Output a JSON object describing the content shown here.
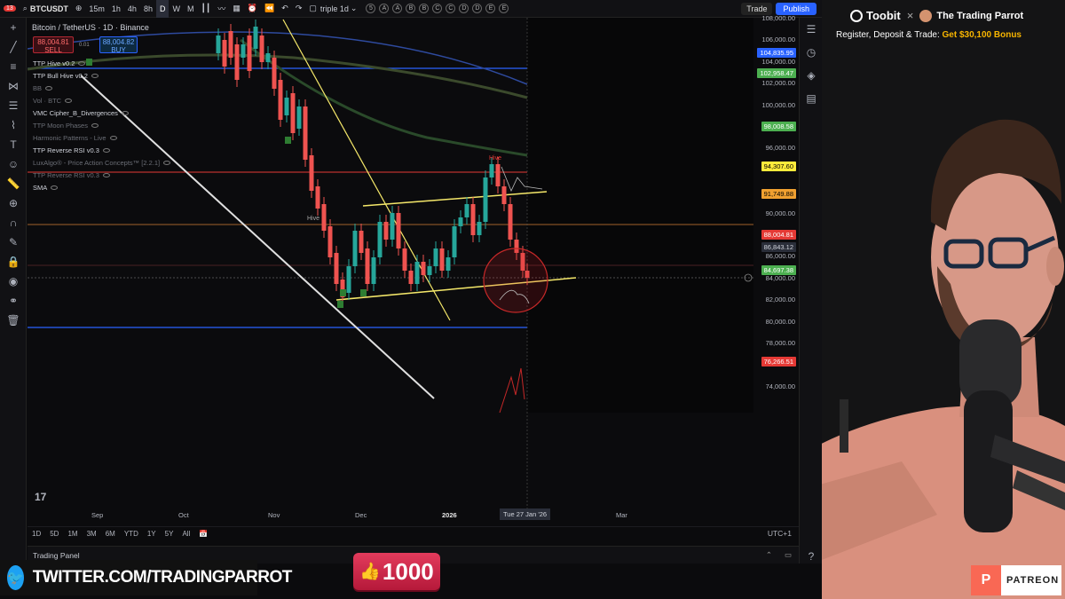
{
  "toolbar": {
    "notif_count": "13",
    "symbol": "BTCUSDT",
    "intervals": [
      "15m",
      "1h",
      "4h",
      "8h",
      "D",
      "W",
      "M"
    ],
    "active_interval": "D",
    "layout_name": "triple 1d",
    "slot_labels": [
      "5",
      "A",
      "A",
      "B",
      "B",
      "C",
      "C",
      "D",
      "D",
      "E",
      "E"
    ],
    "trade_label": "Trade",
    "publish_label": "Publish"
  },
  "chart": {
    "title": "Bitcoin / TetherUS · 1D · Binance",
    "sell_price": "88,004.81",
    "sell_label": "SELL",
    "spread": "0.01",
    "buy_price": "88,004.82",
    "buy_label": "BUY",
    "currency": "USDT",
    "indicators": [
      {
        "label": "TTP Hive v0.2",
        "color": "#d1d4dc"
      },
      {
        "label": "TTP Bull Hive v0.2",
        "color": "#d1d4dc"
      },
      {
        "label": "BB",
        "color": "#6b6e76"
      },
      {
        "label": "Vol · BTC",
        "color": "#6b6e76"
      },
      {
        "label": "VMC Cipher_B_Divergences",
        "color": "#d1d4dc"
      },
      {
        "label": "TTP Moon Phases",
        "color": "#6b6e76"
      },
      {
        "label": "Harmonic Patterns - Live",
        "color": "#6b6e76"
      },
      {
        "label": "TTP Reverse RSI v0.3",
        "color": "#d1d4dc"
      },
      {
        "label": "LuxAlgo® - Price Action Concepts™ [2.2.1]",
        "color": "#6b6e76"
      },
      {
        "label": "TTP Reverse RSI v0.3",
        "color": "#6b6e76"
      },
      {
        "label": "SMA",
        "color": "#d1d4dc"
      }
    ],
    "price_labels": [
      "108,000.00",
      "106,000.00",
      "104,000.00",
      "102,000.00",
      "100,000.00",
      "96,000.00",
      "90,000.00",
      "86,000.00",
      "84,000.00",
      "82,000.00",
      "80,000.00",
      "78,000.00",
      "74,000.00"
    ],
    "price_tags": [
      {
        "text": "104,835.95",
        "bg": "#2962ff",
        "fg": "#ffffff"
      },
      {
        "text": "102,958.47",
        "bg": "#4caf50",
        "fg": "#ffffff"
      },
      {
        "text": "98,008.58",
        "bg": "#4caf50",
        "fg": "#ffffff"
      },
      {
        "text": "94,307.60",
        "bg": "#ffeb3b",
        "fg": "#000000"
      },
      {
        "text": "91,749.88",
        "bg": "#f0a030",
        "fg": "#000000"
      },
      {
        "text": "88,004.81",
        "bg": "#e53935",
        "fg": "#ffffff"
      },
      {
        "text": "86,843.12",
        "bg": "#2a2e39",
        "fg": "#d1d4dc"
      },
      {
        "text": "84,697.38",
        "bg": "#4caf50",
        "fg": "#ffffff"
      },
      {
        "text": "76,266.51",
        "bg": "#e53935",
        "fg": "#ffffff"
      }
    ],
    "time_labels": [
      "Sep",
      "Oct",
      "Nov",
      "Dec",
      "2026",
      "Mar"
    ],
    "crosshair_date": "Tue 27 Jan '26",
    "annotations": [
      "Hive",
      "Hive"
    ],
    "ranges": [
      "1D",
      "5D",
      "1M",
      "3M",
      "6M",
      "YTD",
      "1Y",
      "5Y",
      "All"
    ],
    "timezone": "UTC+1",
    "panel_title": "Trading Panel"
  },
  "sponsor": {
    "brand": "Toobit",
    "partner": "The Trading Parrot",
    "line": "Register, Deposit & Trade:",
    "bonus": "Get $30,100 Bonus"
  },
  "overlay": {
    "twitter": "TWITTER.COM/TRADINGPARROT",
    "likes": "1000",
    "patreon": "PATREON"
  }
}
